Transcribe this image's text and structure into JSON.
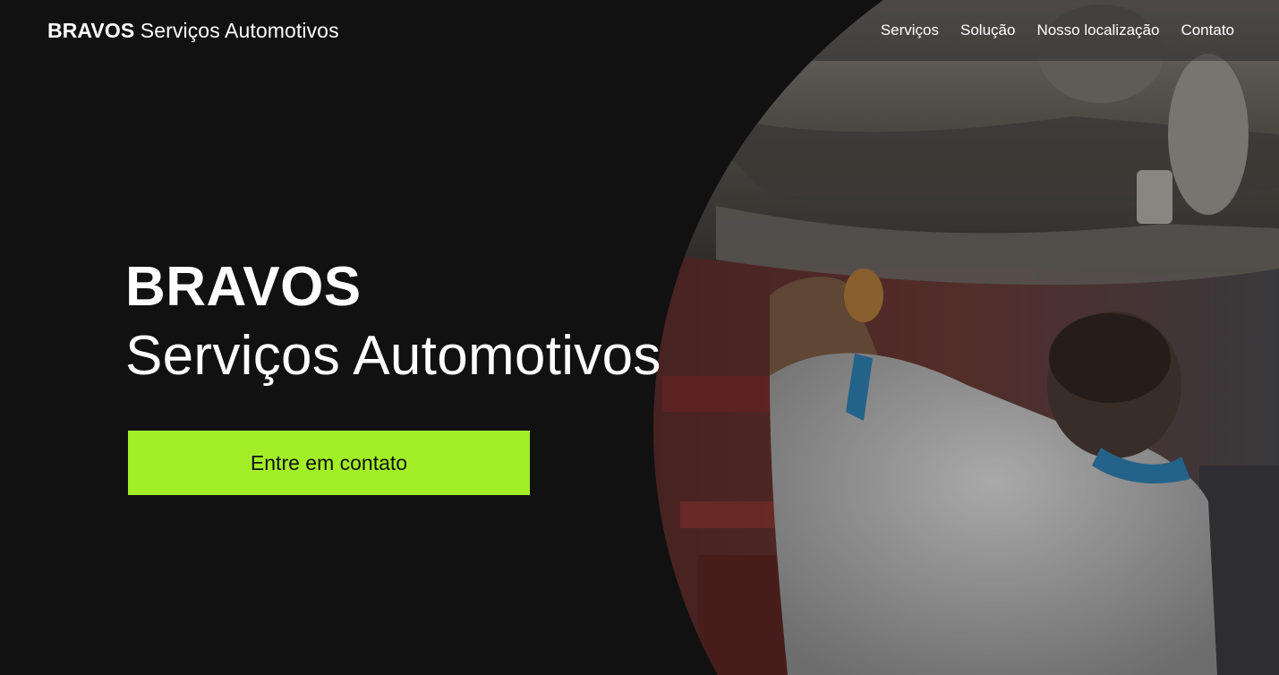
{
  "header": {
    "brand_bold": "BRAVOS",
    "brand_light": "Serviços Automotivos",
    "nav": [
      {
        "label": "Serviços"
      },
      {
        "label": "Solução"
      },
      {
        "label": "Nosso localização"
      },
      {
        "label": "Contato"
      }
    ]
  },
  "hero": {
    "title": "BRAVOS",
    "subtitle": "Serviços Automotivos",
    "cta_label": "Entre em contato",
    "image_subject": "mechanic-under-car-photo"
  },
  "colors": {
    "background": "#111111",
    "accent": "#a3ef27",
    "text": "#ffffff"
  }
}
